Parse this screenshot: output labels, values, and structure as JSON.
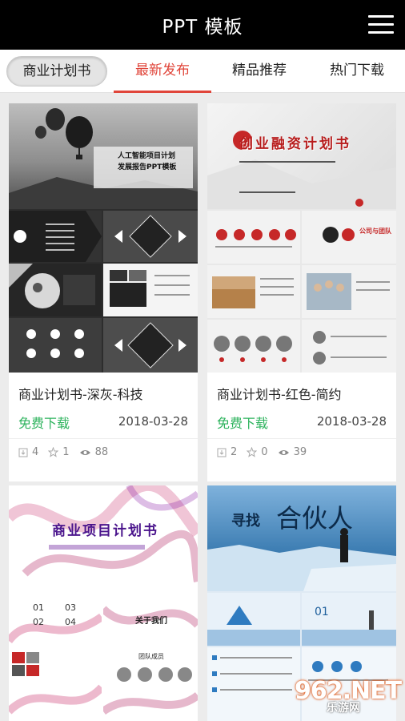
{
  "header": {
    "title": "PPT 模板"
  },
  "tabs": [
    {
      "label": "商业计划书"
    },
    {
      "label": "最新发布"
    },
    {
      "label": "精品推荐"
    },
    {
      "label": "热门下载"
    }
  ],
  "cards": [
    {
      "name": "商业计划书-深灰-科技",
      "free": "免费下载",
      "date": "2018-03-28",
      "downloads": "4",
      "stars": "1",
      "views": "88",
      "cover_title": "人工智能项目计划",
      "cover_sub": "发展报告PPT模板"
    },
    {
      "name": "商业计划书-红色-简约",
      "free": "免费下载",
      "date": "2018-03-28",
      "downloads": "2",
      "stars": "0",
      "views": "39",
      "cover_title": "创业融资计划书",
      "section_title": "公司与团队"
    },
    {
      "cover_title": "商业项目计划书",
      "section_title": "关于我们",
      "sub_title": "团队成员"
    },
    {
      "cover_word1": "寻找",
      "cover_word2": "合伙人",
      "page_num": "01"
    }
  ],
  "watermark": {
    "number": "962.NET",
    "site": "乐游网"
  }
}
